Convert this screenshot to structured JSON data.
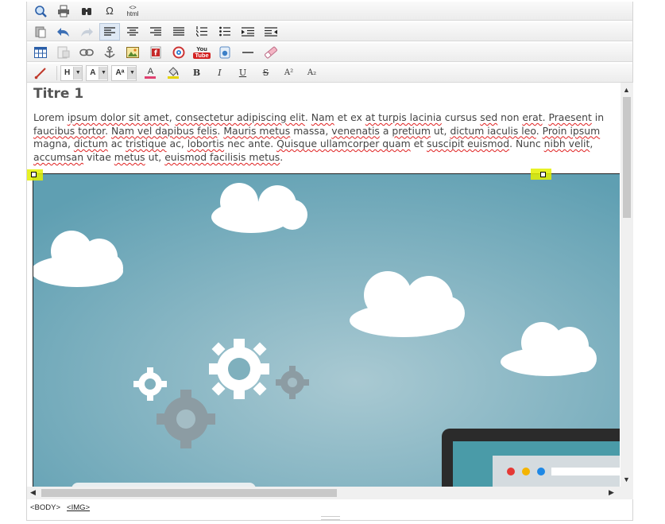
{
  "toolbar": {
    "row1": [
      {
        "name": "preview-icon",
        "label": ""
      },
      {
        "name": "print-icon",
        "label": ""
      },
      {
        "name": "find-icon",
        "label": ""
      },
      {
        "name": "special-char-icon",
        "label": "Ω"
      },
      {
        "name": "html-source-icon",
        "label": "html"
      }
    ],
    "row2": [
      {
        "name": "paste-icon",
        "label": ""
      },
      {
        "name": "undo-icon",
        "label": ""
      },
      {
        "name": "redo-icon",
        "label": ""
      },
      {
        "name": "align-left-icon",
        "label": ""
      },
      {
        "name": "align-center-icon",
        "label": ""
      },
      {
        "name": "align-right-icon",
        "label": ""
      },
      {
        "name": "justify-icon",
        "label": ""
      },
      {
        "name": "ordered-list-icon",
        "label": ""
      },
      {
        "name": "unordered-list-icon",
        "label": ""
      },
      {
        "name": "indent-icon",
        "label": ""
      },
      {
        "name": "outdent-icon",
        "label": ""
      }
    ],
    "row3": [
      {
        "name": "table-icon",
        "label": ""
      },
      {
        "name": "form-icon",
        "label": ""
      },
      {
        "name": "link-icon",
        "label": ""
      },
      {
        "name": "anchor-icon",
        "label": ""
      },
      {
        "name": "image-icon",
        "label": ""
      },
      {
        "name": "flash-icon",
        "label": ""
      },
      {
        "name": "media-icon",
        "label": ""
      },
      {
        "name": "youtube-icon",
        "label": "You Tube"
      },
      {
        "name": "file-icon",
        "label": ""
      },
      {
        "name": "horizontal-rule-icon",
        "label": ""
      },
      {
        "name": "eraser-icon",
        "label": ""
      }
    ],
    "row4": {
      "heading_label": "H",
      "font_label": "A",
      "size_label": "Aᵃ",
      "text_color_label": "A",
      "bold_label": "B",
      "italic_label": "I",
      "underline_label": "U",
      "strike_label": "S",
      "superscript_label": "A²",
      "subscript_label": "A₂"
    }
  },
  "colors": {
    "accent": "#3c6fb5",
    "highlight": "#e3f000",
    "sky": "#6fa6b6"
  },
  "content": {
    "title": "Titre 1",
    "paragraph": [
      {
        "t": "Lorem ",
        "s": false
      },
      {
        "t": "ipsum dolor sit amet",
        "s": true
      },
      {
        "t": ", ",
        "s": false
      },
      {
        "t": "consectetur adipiscing elit",
        "s": true
      },
      {
        "t": ". ",
        "s": false
      },
      {
        "t": "Nam",
        "s": true
      },
      {
        "t": " et ex ",
        "s": false
      },
      {
        "t": "at turpis lacinia",
        "s": true
      },
      {
        "t": " cursus ",
        "s": false
      },
      {
        "t": "sed",
        "s": true
      },
      {
        "t": " non ",
        "s": false
      },
      {
        "t": "erat",
        "s": true
      },
      {
        "t": ". ",
        "s": false
      },
      {
        "t": "Praesent",
        "s": true
      },
      {
        "t": " in ",
        "s": false
      },
      {
        "t": "faucibus tortor",
        "s": true
      },
      {
        "t": ". ",
        "s": false
      },
      {
        "t": "Nam vel dapibus felis",
        "s": true
      },
      {
        "t": ". ",
        "s": false
      },
      {
        "t": "Mauris metus",
        "s": true
      },
      {
        "t": " massa, ",
        "s": false
      },
      {
        "t": "venenatis",
        "s": true
      },
      {
        "t": " a ",
        "s": false
      },
      {
        "t": "pretium",
        "s": true
      },
      {
        "t": " ut, ",
        "s": false
      },
      {
        "t": "dictum iaculis leo",
        "s": true
      },
      {
        "t": ". ",
        "s": false
      },
      {
        "t": "Proin ipsum",
        "s": true
      },
      {
        "t": " magna, ",
        "s": false
      },
      {
        "t": "dictum",
        "s": true
      },
      {
        "t": " ac ",
        "s": false
      },
      {
        "t": "tristique",
        "s": true
      },
      {
        "t": " ac, ",
        "s": false
      },
      {
        "t": "lobortis",
        "s": true
      },
      {
        "t": " nec ante. ",
        "s": false
      },
      {
        "t": "Quisque ullamcorper quam",
        "s": true
      },
      {
        "t": " et ",
        "s": false
      },
      {
        "t": "suscipit euismod",
        "s": true
      },
      {
        "t": ". Nunc ",
        "s": false
      },
      {
        "t": "nibh velit",
        "s": true
      },
      {
        "t": ", ",
        "s": false
      },
      {
        "t": "accumsan",
        "s": true
      },
      {
        "t": " vitae ",
        "s": false
      },
      {
        "t": "metus",
        "s": true
      },
      {
        "t": " ut, ",
        "s": false
      },
      {
        "t": "euismod facilisis metus",
        "s": true
      },
      {
        "t": ".",
        "s": false
      }
    ]
  },
  "statusbar": {
    "path": [
      "<BODY>",
      "<IMG>"
    ]
  }
}
